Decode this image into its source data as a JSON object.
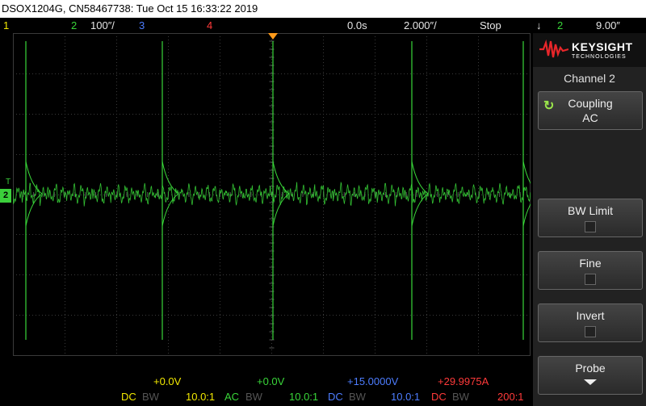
{
  "title": "DSOX1204G, CN58467738: Tue Oct 15 16:33:22 2019",
  "status": {
    "ch1": "1",
    "ch2": "2",
    "ch2_scale": "100″/",
    "ch3": "3",
    "ch4": "4",
    "time_offset": "0.0s",
    "time_scale": "2.000″/",
    "run_state": "Stop",
    "trigger_symbol": "↓",
    "trigger_source": "2",
    "trigger_level": "9.00″"
  },
  "sidebar": {
    "brand": "KEYSIGHT",
    "brand_sub": "TECHNOLOGIES",
    "menu_title": "Channel 2",
    "coupling_label": "Coupling",
    "coupling_value": "AC",
    "bw_limit_label": "BW Limit",
    "fine_label": "Fine",
    "invert_label": "Invert",
    "probe_label": "Probe"
  },
  "channels": [
    {
      "offset": "+0.0V",
      "coupling": "DC",
      "bw": "BW",
      "probe": "10.0:1"
    },
    {
      "offset": "+0.0V",
      "coupling": "AC",
      "bw": "BW",
      "probe": "10.0:1"
    },
    {
      "offset": "+15.0000V",
      "coupling": "DC",
      "bw": "BW",
      "probe": "10.0:1"
    },
    {
      "offset": "+29.9975A",
      "coupling": "DC",
      "bw": "BW",
      "probe": "200:1"
    }
  ],
  "markers": {
    "trigger_level": "T",
    "ch2_ground": "2"
  },
  "colors": {
    "ch1": "#f2e800",
    "ch2": "#39d639",
    "ch3": "#4d7dff",
    "ch4": "#ff3a3a",
    "trigger_marker": "#ff9a1a"
  }
}
